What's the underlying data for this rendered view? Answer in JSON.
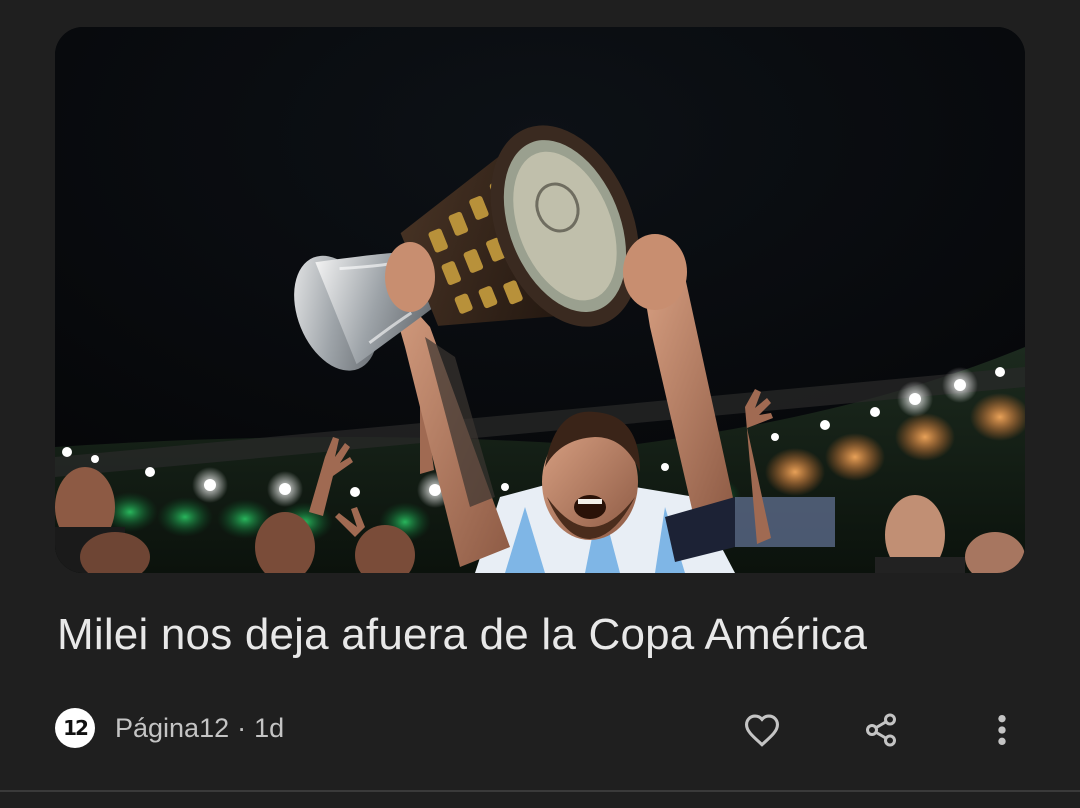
{
  "article": {
    "headline": "Milei nos deja afuera de la Copa América",
    "source": {
      "name": "Página12",
      "logo_text": "12"
    },
    "separator": "·",
    "age": "1d",
    "image_alt": "Messi lifting the Copa América trophy in a stadium at night"
  },
  "actions": {
    "like_icon": "heart-icon",
    "share_icon": "share-icon",
    "more_icon": "more-vert-icon"
  },
  "colors": {
    "background": "#1f1f1f",
    "headline": "#e8e8e8",
    "meta_text": "#c4c4c4",
    "icon": "#c4c4c4"
  }
}
